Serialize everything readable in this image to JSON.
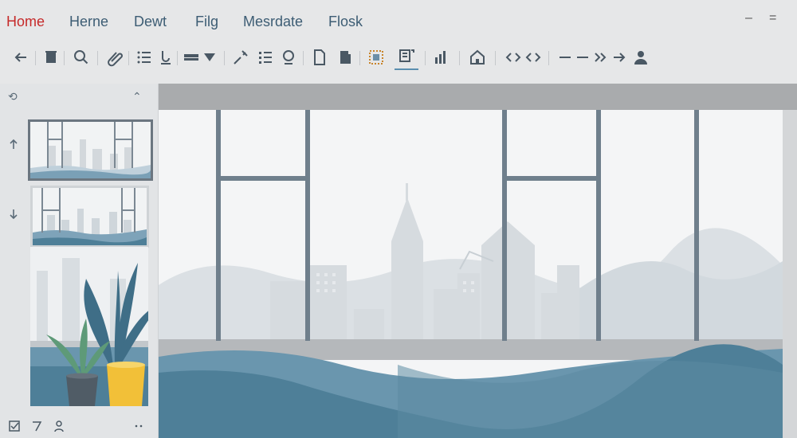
{
  "menu": {
    "items": [
      {
        "label": "Home",
        "active": true
      },
      {
        "label": "Herne",
        "active": false
      },
      {
        "label": "Dewt",
        "active": false
      },
      {
        "label": "Filg",
        "active": false
      },
      {
        "label": "Mesrdate",
        "active": false
      },
      {
        "label": "Flosk",
        "active": false
      }
    ],
    "window_controls": {
      "minimize": "–",
      "menu": "="
    }
  },
  "toolbar": {
    "icons": [
      "back-arrow-icon",
      "trash-icon",
      "search-icon",
      "attach-icon",
      "bullet-list-icon",
      "text-format-icon",
      "layout-icon",
      "dropdown-triangle-icon",
      "tools-icon",
      "numbered-list-icon",
      "shape-icon",
      "page-icon",
      "bookmark-icon",
      "image-select-icon",
      "crop-icon",
      "chart-icon",
      "home-icon",
      "code-left-icon",
      "code-right-icon",
      "dash-icon",
      "dash-icon",
      "forward-double-icon",
      "arrow-right-icon",
      "user-icon"
    ]
  },
  "sidepanel": {
    "header_left_icon": "⟲",
    "header_right_icon": "⌃",
    "thumbnails": [
      "Slide 1",
      "Slide 2",
      "Slide 3"
    ],
    "footer_icons": [
      "check-box-icon",
      "seven-icon",
      "person-icon",
      "more-icon"
    ]
  },
  "colors": {
    "accent_red": "#c62a2a",
    "menu_text": "#3d5d74",
    "wave_blue": "#4e7f98",
    "frame": "#6f7f8c"
  }
}
